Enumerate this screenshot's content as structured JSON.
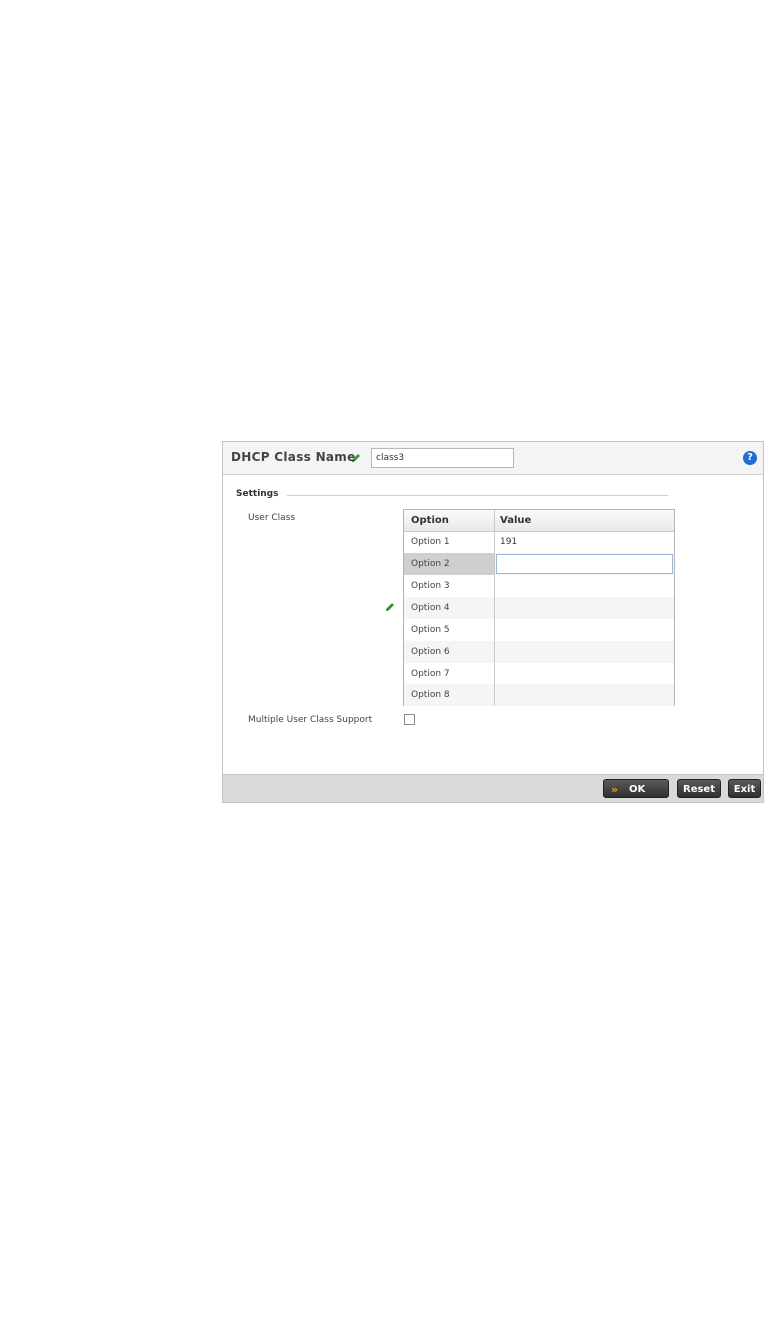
{
  "dialog": {
    "header": {
      "title": "DHCP Class Name",
      "name_value": "class3",
      "help_icon": "help-icon"
    },
    "settings": {
      "section_label": "Settings",
      "user_class_label": "User Class",
      "multiple_support_label": "Multiple User Class Support",
      "multiple_support_checked": false
    },
    "grid": {
      "columns": [
        "Option",
        "Value"
      ],
      "rows": [
        {
          "option": "Option 1",
          "value": "191"
        },
        {
          "option": "Option 2",
          "value": ""
        },
        {
          "option": "Option 3",
          "value": ""
        },
        {
          "option": "Option 4",
          "value": ""
        },
        {
          "option": "Option 5",
          "value": ""
        },
        {
          "option": "Option 6",
          "value": ""
        },
        {
          "option": "Option 7",
          "value": ""
        },
        {
          "option": "Option 8",
          "value": ""
        }
      ],
      "selected_row": "Option 2"
    },
    "footer": {
      "ok_label": "OK",
      "reset_label": "Reset",
      "exit_label": "Exit"
    },
    "colors": {
      "accent": "#1f6fd0",
      "ok_chevron": "#f39c1a",
      "pencil": "#2e9a2e"
    }
  }
}
